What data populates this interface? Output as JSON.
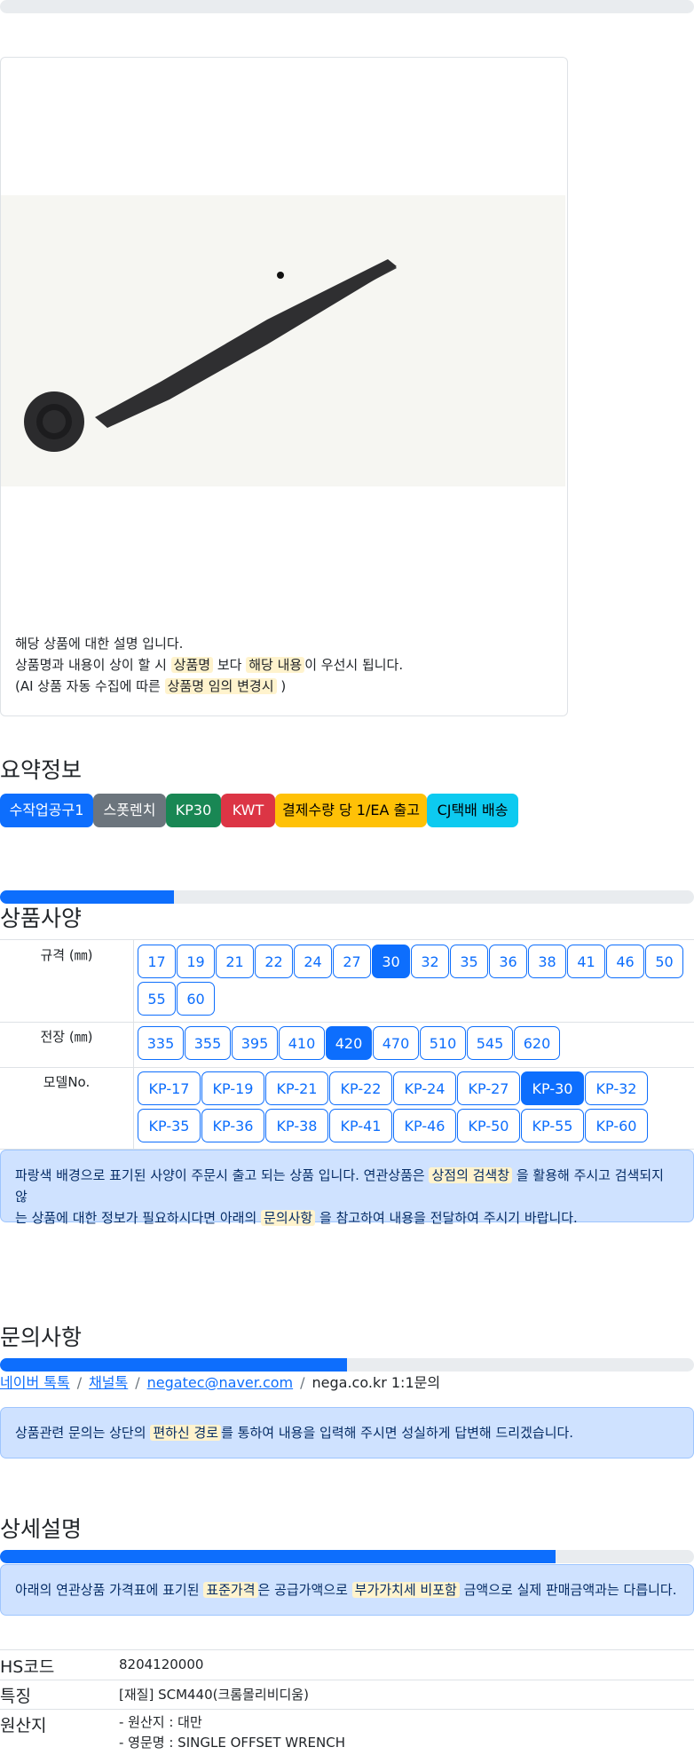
{
  "top_progress": {
    "fill_percent": 0
  },
  "product": {
    "image_alt": "single offset wrench",
    "desc_line1": "해당 상품에 대한 설명 입니다.",
    "desc_line2_a": "상품명과 내용이 상이 할 시",
    "desc_line2_hl1": "상품명",
    "desc_line2_b": "보다",
    "desc_line2_hl2": "해당 내용",
    "desc_line2_c": "이 우선시 됩니다.",
    "desc_line3_a": "(AI 상품 자동 수집에 따른",
    "desc_line3_hl": "상품명 임의 변경시",
    "desc_line3_b": ")"
  },
  "summary": {
    "title": "요약정보",
    "badges": [
      {
        "label": "수작업공구1",
        "color": "#0d6efd"
      },
      {
        "label": "스폿렌치",
        "color": "#6c757d"
      },
      {
        "label": "KP30",
        "color": "#198754"
      },
      {
        "label": "KWT",
        "color": "#dc3545"
      },
      {
        "label": "결제수량 당 1/EA 출고",
        "color": "#ffc107"
      },
      {
        "label": "CJ택배 배송",
        "color": "#0dcaf0"
      }
    ]
  },
  "spec": {
    "progress_percent": 25,
    "title": "상품사양",
    "rows": [
      {
        "label": "규격 (㎜)",
        "options": [
          "17",
          "19",
          "21",
          "22",
          "24",
          "27",
          "30",
          "32",
          "35",
          "36",
          "38",
          "41",
          "46",
          "50",
          "55",
          "60"
        ],
        "selected": "30"
      },
      {
        "label": "전장 (㎜)",
        "options": [
          "335",
          "355",
          "395",
          "410",
          "420",
          "470",
          "510",
          "545",
          "620"
        ],
        "selected": "420"
      },
      {
        "label": "모델No.",
        "options": [
          "KP-17",
          "KP-19",
          "KP-21",
          "KP-22",
          "KP-24",
          "KP-27",
          "KP-30",
          "KP-32",
          "KP-35",
          "KP-36",
          "KP-38",
          "KP-41",
          "KP-46",
          "KP-50",
          "KP-55",
          "KP-60"
        ],
        "selected": "KP-30"
      }
    ],
    "note_a": "파랑색 배경으로 표기된 사양이 주문시 출고 되는 상품 입니다. 연관상품은",
    "note_hl1": "상점의 검색창",
    "note_b": "을 활용해 주시고 검색되지 않",
    "note_c": "는 상품에 대한 정보가 필요하시다면 아래의",
    "note_hl2": "문의사항",
    "note_d": "을 참고하여 내용을 전달하여 주시기 바랍니다."
  },
  "inquiry": {
    "title": "문의사항",
    "progress_percent": 50,
    "links": [
      "네이버 톡톡",
      "채널톡",
      "negatec@naver.com"
    ],
    "last": "nega.co.kr 1:1문의",
    "note_a": "상품관련 문의는 상단의",
    "note_hl": "편하신 경로",
    "note_b": "를 통하여 내용을 입력해 주시면 성실하게 답변해 드리겠습니다."
  },
  "detail": {
    "title": "상세설명",
    "progress_percent": 80,
    "note_a": "아래의 연관상품 가격표에 표기된",
    "note_hl1": "표준가격",
    "note_b": "은 공급가액으로",
    "note_hl2": "부가가치세 비포함",
    "note_c": "금액으로 실제 판매금액과는 다릅니다.",
    "info": [
      {
        "key": "HS코드",
        "values": [
          "8204120000"
        ]
      },
      {
        "key": "특징",
        "values": [
          "[재질] SCM440(크롬몰리비디움)"
        ]
      },
      {
        "key": "원산지",
        "values": [
          "- 원산지 : 대만",
          "- 영문명 : SINGLE OFFSET WRENCH"
        ]
      }
    ]
  }
}
